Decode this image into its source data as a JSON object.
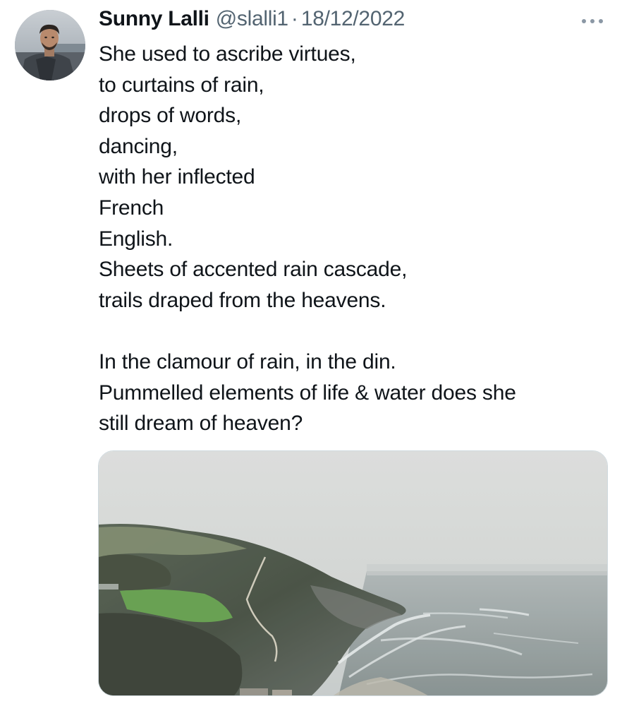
{
  "tweet": {
    "author": {
      "display_name": "Sunny Lalli",
      "handle": "@slalli1",
      "separator": "·",
      "date": "18/12/2022",
      "avatar_icon": "avatar-photo"
    },
    "more_icon": "more-horizontal-icon",
    "text": {
      "stanza1": [
        "She used to ascribe virtues,",
        "to curtains of rain,",
        "drops of words,",
        "dancing,",
        "with her inflected",
        "French",
        "English.",
        "Sheets of accented rain cascade,",
        "trails draped from the heavens."
      ],
      "stanza2": [
        "In the clamour of rain, in the din.",
        "Pummelled elements of life & water does she",
        "still dream of heaven?"
      ]
    },
    "media": {
      "type": "photo",
      "scene": "coastal-headland-rain"
    }
  },
  "colors": {
    "text_primary": "#0f1419",
    "text_secondary": "#536471",
    "border": "#cfd9de"
  }
}
